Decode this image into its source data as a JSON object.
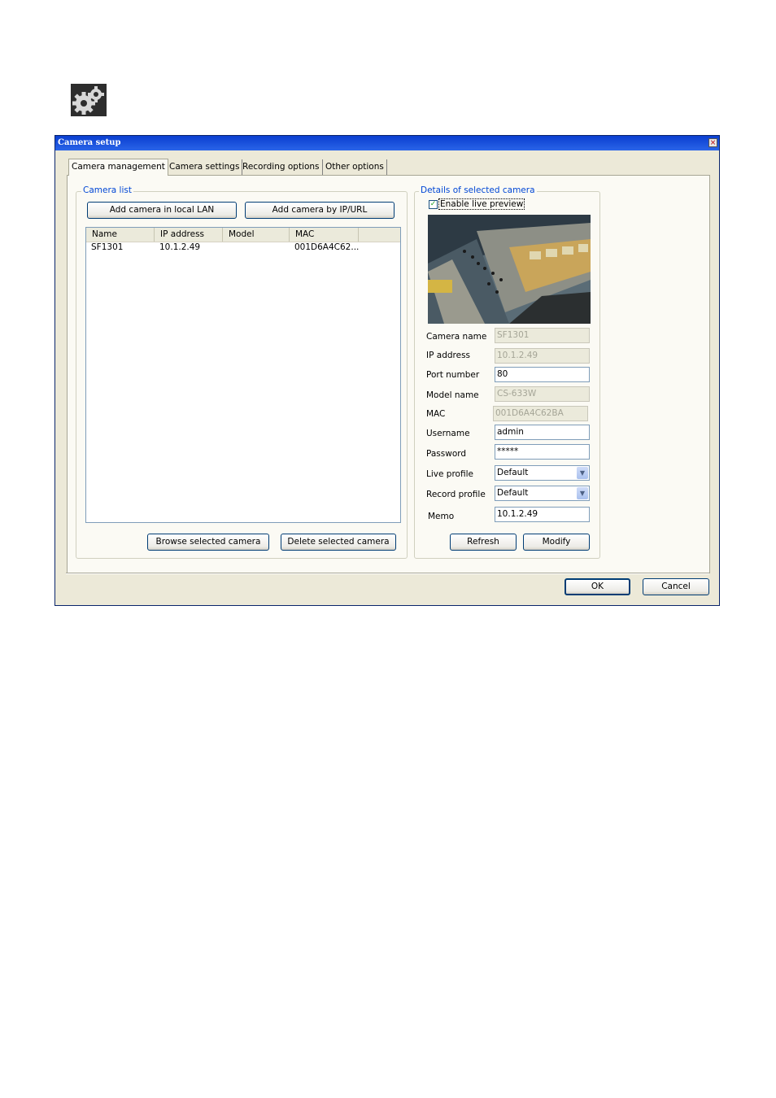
{
  "dialog": {
    "title": "Camera setup",
    "close_label": "×",
    "tabs": [
      {
        "label": "Camera management"
      },
      {
        "label": "Camera settings"
      },
      {
        "label": "Recording options"
      },
      {
        "label": "Other options"
      }
    ],
    "camera_list": {
      "legend": "Camera list",
      "add_lan_label": "Add camera in local LAN",
      "add_ip_label": "Add camera by IP/URL",
      "columns": [
        "Name",
        "IP address",
        "Model",
        "MAC"
      ],
      "rows": [
        {
          "name": "SF1301",
          "ip": "10.1.2.49",
          "model": "",
          "mac": "001D6A4C62..."
        }
      ],
      "browse_label": "Browse selected camera",
      "delete_label": "Delete selected camera"
    },
    "details": {
      "legend": "Details of selected camera",
      "enable_preview_label": "Enable live preview",
      "enable_preview_checked": true,
      "fields": {
        "camera_name": {
          "label": "Camera name",
          "value": "SF1301"
        },
        "ip_address": {
          "label": "IP address",
          "value": "10.1.2.49"
        },
        "port_number": {
          "label": "Port number",
          "value": "80"
        },
        "model_name": {
          "label": "Model name",
          "value": "CS-633W"
        },
        "mac": {
          "label": "MAC",
          "value": "001D6A4C62BA"
        },
        "username": {
          "label": "Username",
          "value": "admin"
        },
        "password": {
          "label": "Password",
          "value": "*****"
        },
        "live_profile": {
          "label": "Live profile",
          "value": "Default"
        },
        "record_profile": {
          "label": "Record profile",
          "value": "Default"
        },
        "memo": {
          "label": "Memo",
          "value": "10.1.2.49"
        }
      },
      "refresh_label": "Refresh",
      "modify_label": "Modify"
    },
    "ok_label": "OK",
    "cancel_label": "Cancel"
  },
  "colors": {
    "title_bar": "#0a3fd0",
    "group_legend": "#0046d5",
    "dialog_bg": "#ece9d8"
  }
}
